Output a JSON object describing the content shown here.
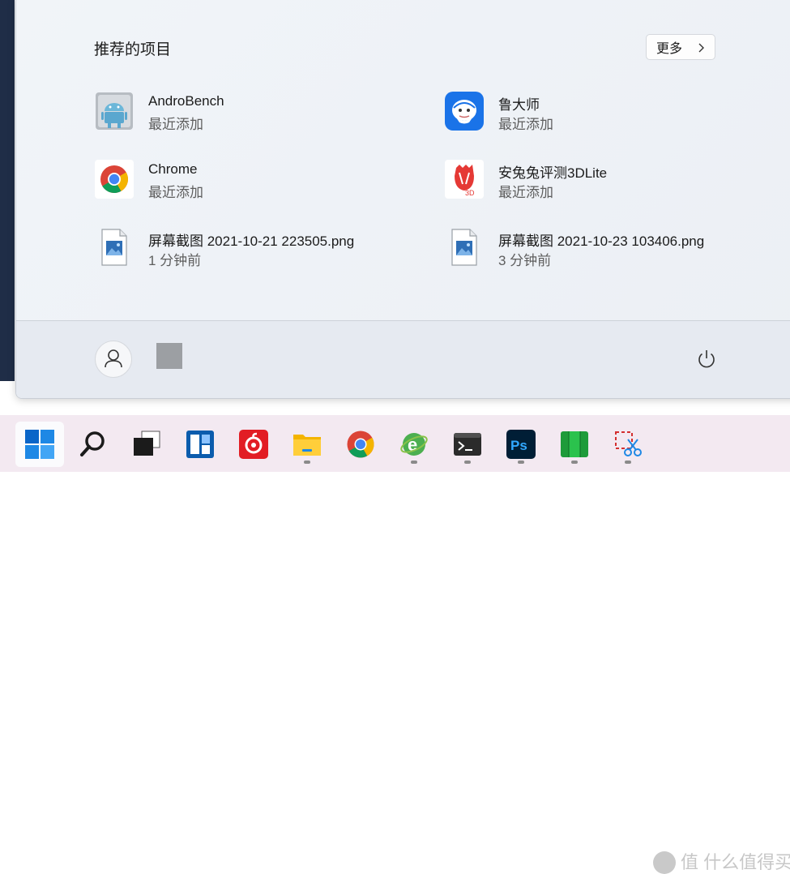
{
  "recommended": {
    "title": "推荐的项目",
    "more_label": "更多",
    "items": [
      {
        "name": "AndroBench",
        "sub": "最近添加",
        "icon": "androbench-icon"
      },
      {
        "name": "鲁大师",
        "sub": "最近添加",
        "icon": "ludashi-icon"
      },
      {
        "name": "Chrome",
        "sub": "最近添加",
        "icon": "chrome-icon"
      },
      {
        "name": "安兔兔评测3DLite",
        "sub": "最近添加",
        "icon": "antutu-icon"
      },
      {
        "name": "屏幕截图 2021-10-21 223505.png",
        "sub": "1 分钟前",
        "icon": "image-file-icon"
      },
      {
        "name": "屏幕截图 2021-10-23 103406.png",
        "sub": "3 分钟前",
        "icon": "image-file-icon"
      }
    ]
  },
  "footer": {
    "user_icon": "user-icon",
    "power_icon": "power-icon"
  },
  "taskbar": {
    "items": [
      "start-button",
      "search",
      "task-view",
      "widgets",
      "netease-music",
      "file-explorer",
      "chrome",
      "ie-browser",
      "terminal",
      "photoshop",
      "green-app",
      "snipping-tool"
    ],
    "watermark": "值 什么值得买"
  },
  "colors": {
    "accent": "#0a65c8",
    "taskbar_bg": "#f3e9f1"
  }
}
